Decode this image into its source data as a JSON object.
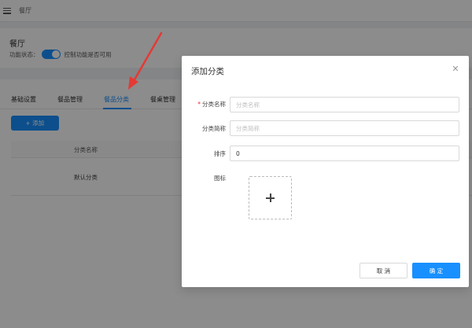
{
  "topbar": {
    "title": "餐厅",
    "menu_icon": "hamburger-menu-icon"
  },
  "restaurant": {
    "name": "餐厅",
    "status_label": "功能状态：",
    "status_enabled": true,
    "status_hint": "控制功能是否可用"
  },
  "tabs": [
    {
      "label": "基础设置",
      "active": false
    },
    {
      "label": "餐品管理",
      "active": false
    },
    {
      "label": "餐品分类",
      "active": true
    },
    {
      "label": "餐桌管理",
      "active": false
    }
  ],
  "toolbar": {
    "add_label": "添加"
  },
  "table": {
    "columns": [
      "分类名称"
    ],
    "rows": [
      [
        "默认分类"
      ]
    ]
  },
  "modal": {
    "title": "添加分类",
    "close_icon": "close-icon",
    "fields": {
      "name": {
        "label": "分类名称",
        "required": true,
        "value": "",
        "placeholder": "分类名称"
      },
      "short_name": {
        "label": "分类简称",
        "required": false,
        "value": "",
        "placeholder": "分类简称"
      },
      "sort": {
        "label": "排序",
        "required": false,
        "value": "0",
        "placeholder": ""
      },
      "icon": {
        "label": "图标"
      }
    },
    "cancel_label": "取 消",
    "ok_label": "确 定"
  },
  "colors": {
    "primary": "#1890ff",
    "required": "#f5222d",
    "annotation_arrow": "#e53935"
  }
}
